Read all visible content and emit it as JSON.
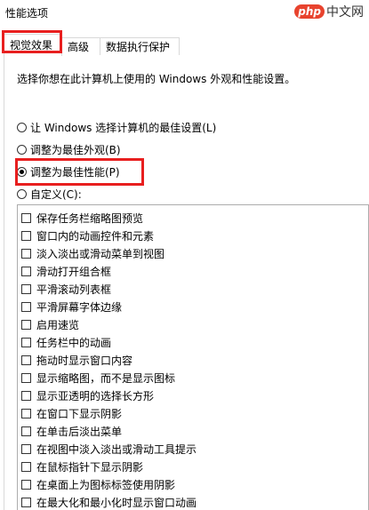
{
  "window": {
    "title": "性能选项"
  },
  "watermark": {
    "logo": "php",
    "text": "中文网"
  },
  "tabs": [
    {
      "label": "视觉效果",
      "active": true
    },
    {
      "label": "高级",
      "active": false
    },
    {
      "label": "数据执行保护",
      "active": false
    }
  ],
  "description": "选择你想在此计算机上使用的 Windows 外观和性能设置。",
  "radios": [
    {
      "label": "让 Windows 选择计算机的最佳设置(L)",
      "checked": false
    },
    {
      "label": "调整为最佳外观(B)",
      "checked": false
    },
    {
      "label": "调整为最佳性能(P)",
      "checked": true
    },
    {
      "label": "自定义(C):",
      "checked": false
    }
  ],
  "effects": [
    {
      "label": "保存任务栏缩略图预览",
      "checked": false
    },
    {
      "label": "窗口内的动画控件和元素",
      "checked": false
    },
    {
      "label": "淡入淡出或滑动菜单到视图",
      "checked": false
    },
    {
      "label": "滑动打开组合框",
      "checked": false
    },
    {
      "label": "平滑滚动列表框",
      "checked": false
    },
    {
      "label": "平滑屏幕字体边缘",
      "checked": false
    },
    {
      "label": "启用速览",
      "checked": false
    },
    {
      "label": "任务栏中的动画",
      "checked": false
    },
    {
      "label": "拖动时显示窗口内容",
      "checked": false
    },
    {
      "label": "显示缩略图，而不是显示图标",
      "checked": false
    },
    {
      "label": "显示亚透明的选择长方形",
      "checked": false
    },
    {
      "label": "在窗口下显示阴影",
      "checked": false
    },
    {
      "label": "在单击后淡出菜单",
      "checked": false
    },
    {
      "label": "在视图中淡入淡出或滑动工具提示",
      "checked": false
    },
    {
      "label": "在鼠标指针下显示阴影",
      "checked": false
    },
    {
      "label": "在桌面上为图标标签使用阴影",
      "checked": false
    },
    {
      "label": "在最大化和最小化时显示窗口动画",
      "checked": false
    }
  ],
  "colors": {
    "highlight": "#e81f1f",
    "border": "#d9d9d9"
  }
}
